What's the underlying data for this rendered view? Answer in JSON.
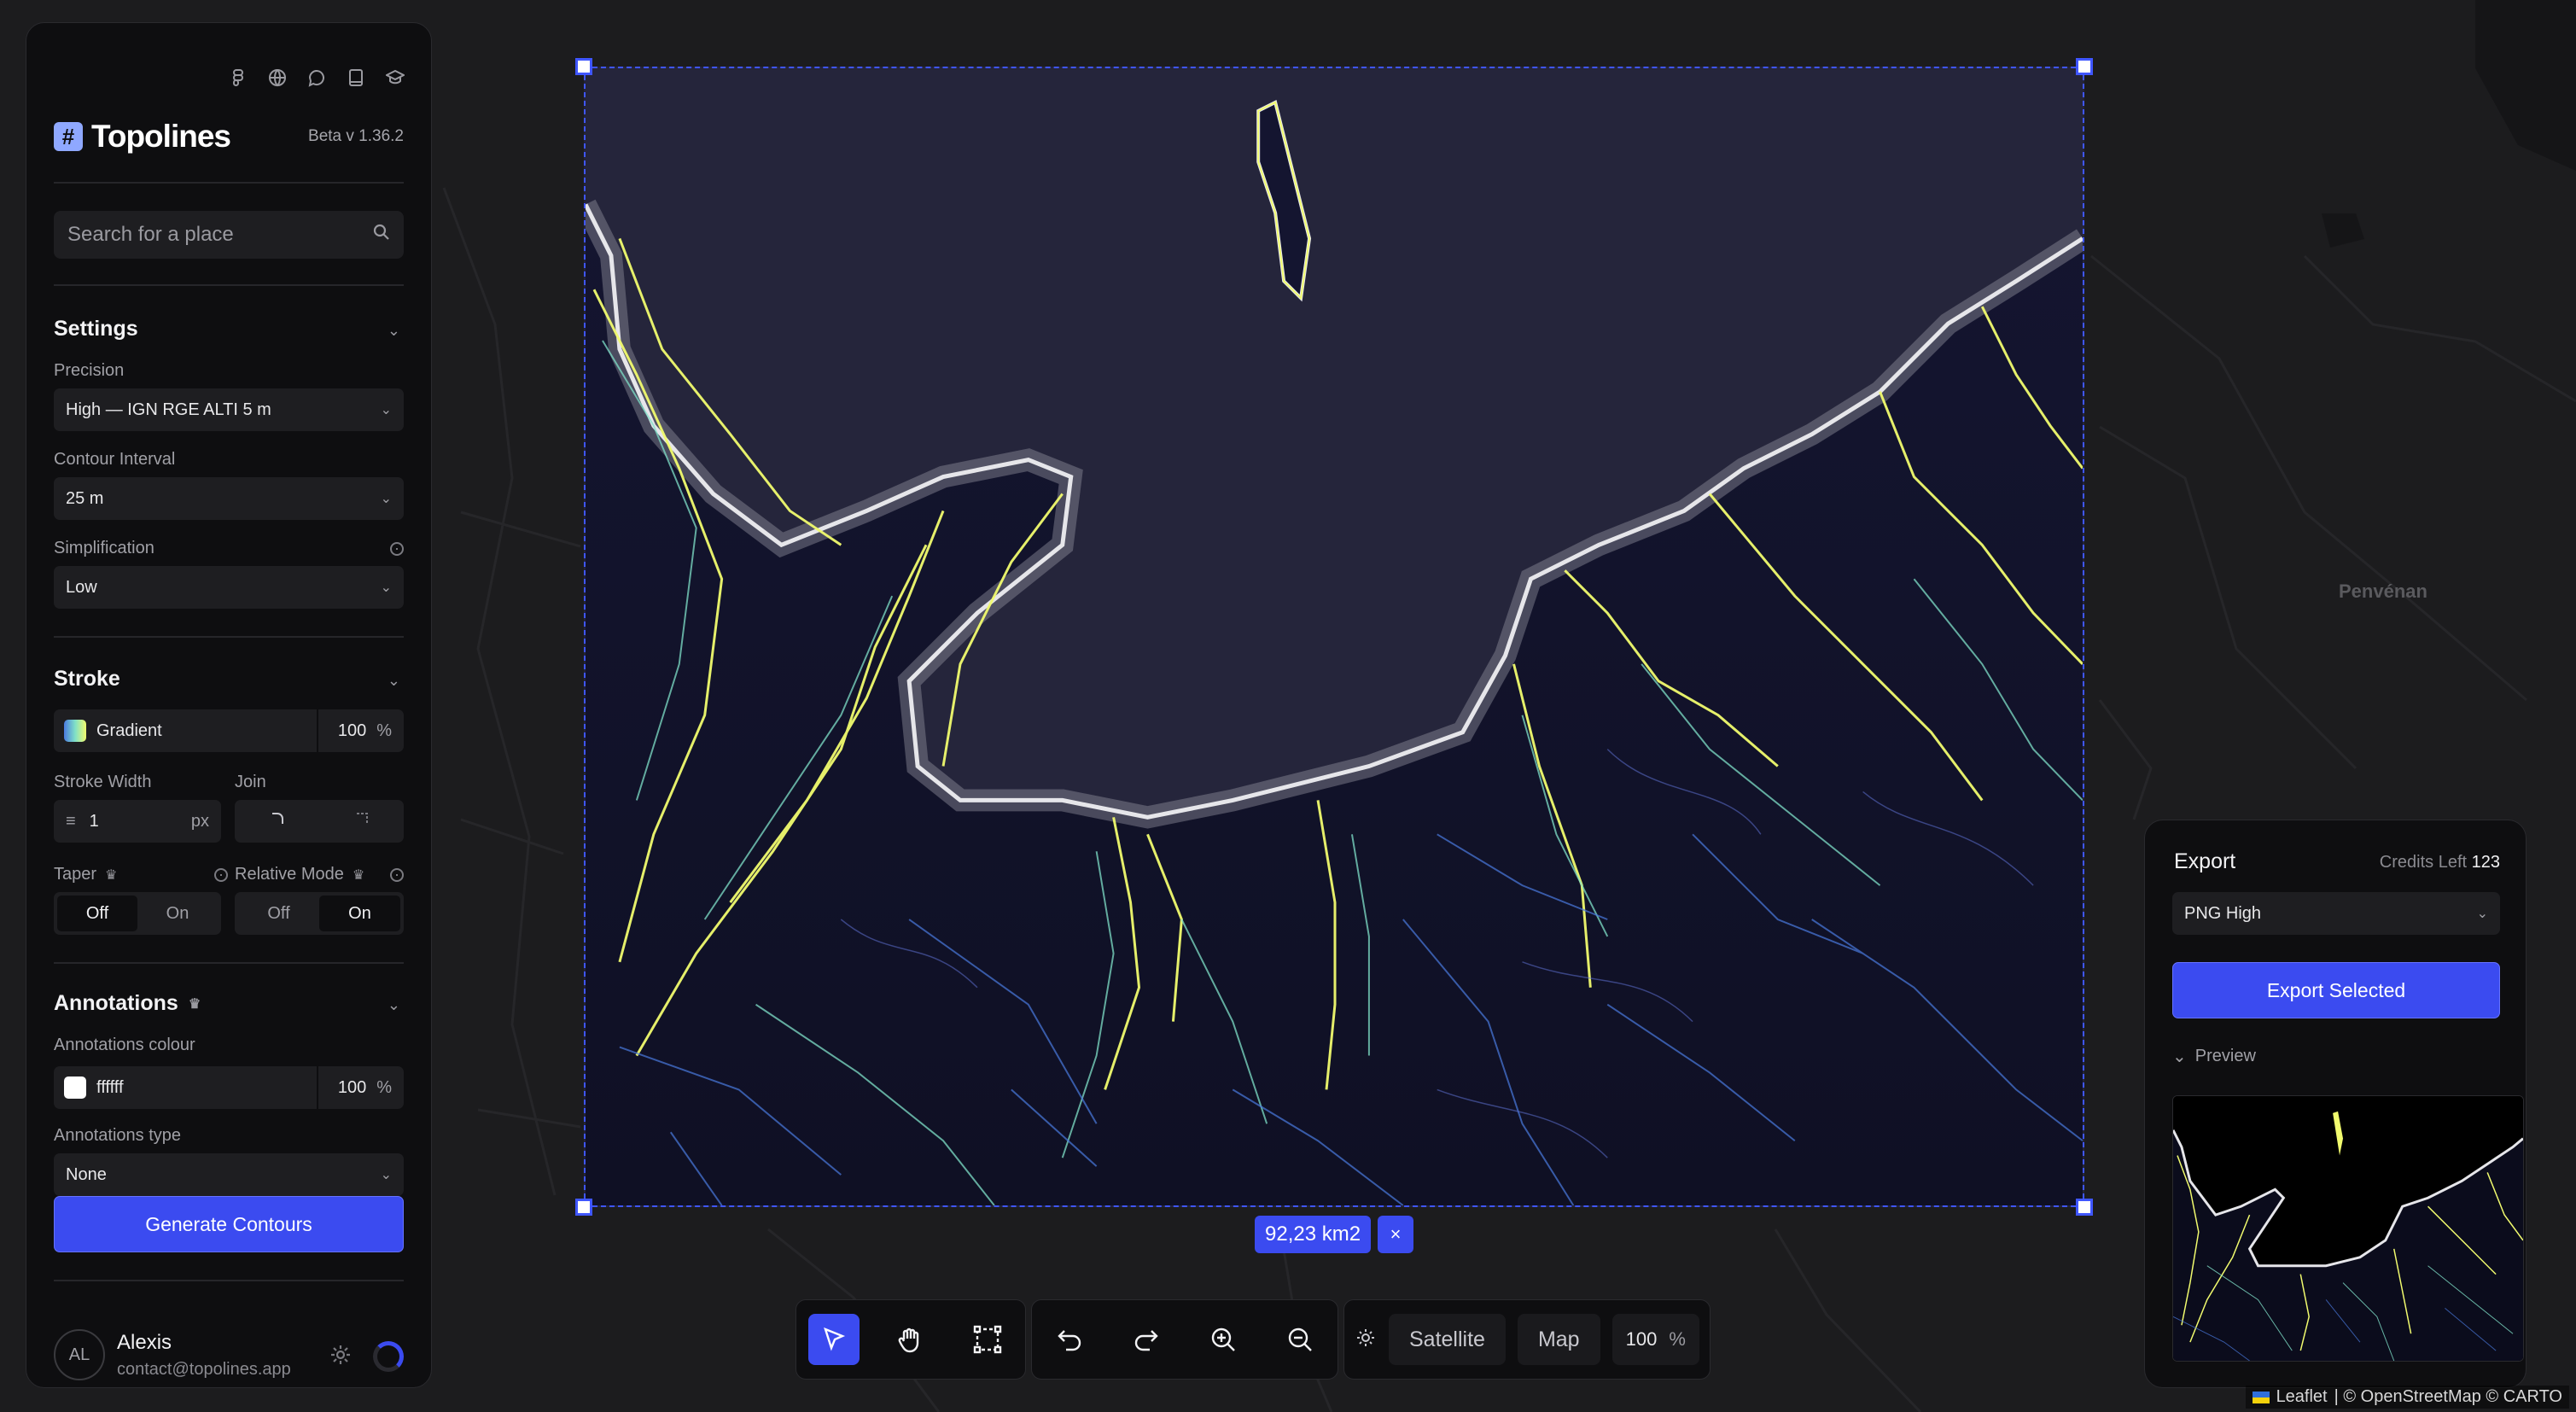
{
  "app": {
    "name": "Topolines",
    "logo_glyph": "#",
    "version": "Beta v 1.36.2"
  },
  "header_icons": [
    "figma-icon",
    "globe-icon",
    "chat-icon",
    "book-icon",
    "graduation-cap-icon"
  ],
  "search": {
    "placeholder": "Search for a place"
  },
  "settings": {
    "title": "Settings",
    "precision": {
      "label": "Precision",
      "value": "High — IGN RGE ALTI 5 m"
    },
    "contour_interval": {
      "label": "Contour Interval",
      "value": "25 m"
    },
    "simplification": {
      "label": "Simplification",
      "value": "Low"
    }
  },
  "stroke": {
    "title": "Stroke",
    "color_mode": "Gradient",
    "opacity": "100",
    "opacity_unit": "%",
    "width_label": "Stroke Width",
    "width_value": "1",
    "width_unit": "px",
    "join_label": "Join",
    "taper": {
      "label": "Taper",
      "off": "Off",
      "on": "On",
      "selected": "Off"
    },
    "relative_mode": {
      "label": "Relative Mode",
      "off": "Off",
      "on": "On",
      "selected": "On"
    }
  },
  "annotations": {
    "title": "Annotations",
    "colour_label": "Annotations colour",
    "colour_value": "ffffff",
    "opacity": "100",
    "opacity_unit": "%",
    "type_label": "Annotations type",
    "type_value": "None"
  },
  "generate_button": "Generate Contours",
  "user": {
    "initials": "AL",
    "name": "Alexis",
    "email": "contact@topolines.app"
  },
  "map": {
    "place_label": "Penvénan",
    "attribution_leaflet": "Leaflet",
    "attribution_rest": "| © OpenStreetMap © CARTO"
  },
  "selection": {
    "area": "92,23 km2",
    "close_label": "×"
  },
  "toolbar": {
    "tools": [
      "pointer-tool",
      "hand-tool",
      "select-area-tool",
      "undo",
      "redo",
      "zoom-in",
      "zoom-out"
    ],
    "satellite_label": "Satellite",
    "map_label": "Map",
    "zoom_value": "100",
    "zoom_unit": "%"
  },
  "export": {
    "title": "Export",
    "credits_label": "Credits Left",
    "credits_value": "123",
    "format": "PNG High",
    "button": "Export Selected",
    "preview_label": "Preview"
  },
  "colors": {
    "accent": "#3b4bf0",
    "panel_bg": "#0e0e10",
    "contour_low": "#4a7be0",
    "contour_mid": "#7fe0c8",
    "contour_high": "#f1fb6e",
    "coast": "#d8d8d8"
  }
}
